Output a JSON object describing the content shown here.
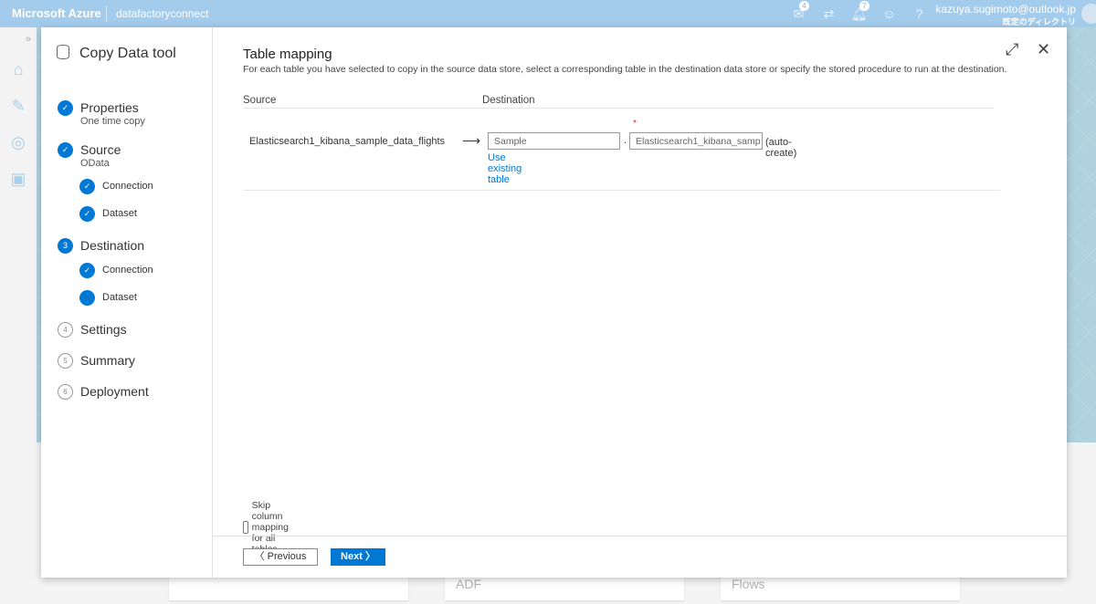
{
  "topbar": {
    "brand": "Microsoft Azure",
    "factory": "datafactoryconnect",
    "user_email": "kazuya.sugimoto@outlook.jp",
    "directory": "既定のディレクトリ",
    "notification_badge": "4",
    "alert_badge": "7"
  },
  "rail": {
    "expand": "»"
  },
  "background_cards": [
    "",
    "ADF",
    "Flows"
  ],
  "wizard": {
    "title": "Copy Data tool",
    "steps": [
      {
        "label": "Properties",
        "sub": "One time copy",
        "state": "done"
      },
      {
        "label": "Source",
        "sub": "OData",
        "state": "done"
      },
      {
        "label": "Connection",
        "state": "done"
      },
      {
        "label": "Dataset",
        "state": "done"
      },
      {
        "label": "Destination",
        "num": "3",
        "state": "current"
      },
      {
        "label": "Connection",
        "state": "done"
      },
      {
        "label": "Dataset",
        "state": "current"
      },
      {
        "label": "Settings",
        "num": "4",
        "state": "pending"
      },
      {
        "label": "Summary",
        "num": "5",
        "state": "pending"
      },
      {
        "label": "Deployment",
        "num": "6",
        "state": "pending"
      }
    ]
  },
  "main": {
    "title": "Table mapping",
    "description": "For each table you have selected to copy in the source data store, select a corresponding table in the destination data store or specify the stored procedure to run at the destination.",
    "col_source": "Source",
    "col_destination": "Destination",
    "row": {
      "source": "Elasticsearch1_kibana_sample_data_flights",
      "schema": "Sample",
      "dot": ".",
      "table": "Elasticsearch1_kibana_samp",
      "required": "*",
      "auto_create": "(auto-create)",
      "use_existing": "Use existing table"
    },
    "skip_label": "Skip column mapping for all tables",
    "skip_checked": false
  },
  "footer": {
    "previous": "〈 Previous",
    "next": "Next 〉"
  },
  "colors": {
    "accent": "#0078d4",
    "topbar": "#a3cbec"
  }
}
